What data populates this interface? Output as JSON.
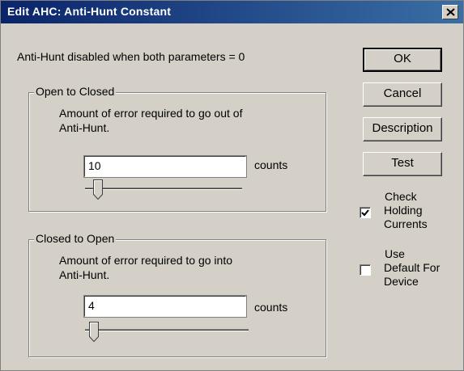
{
  "window": {
    "title": "Edit AHC: Anti-Hunt Constant"
  },
  "info_text": "Anti-Hunt disabled when both parameters = 0",
  "open_to_closed": {
    "legend": "Open to Closed",
    "desc_line1": "Amount of error required to go out of",
    "desc_line2": "Anti-Hunt.",
    "value": "10",
    "unit": "counts"
  },
  "closed_to_open": {
    "legend": "Closed to Open",
    "desc_line1": "Amount of error required to go into",
    "desc_line2": "Anti-Hunt.",
    "value": "4",
    "unit": "counts"
  },
  "buttons": {
    "ok": "OK",
    "cancel": "Cancel",
    "description": "Description",
    "test": "Test"
  },
  "check_holding": {
    "checked": true,
    "line1": "Check",
    "line2": "Holding",
    "line3": "Currents"
  },
  "use_default": {
    "checked": false,
    "line1": "Use",
    "line2": "Default For",
    "line3": "Device"
  }
}
